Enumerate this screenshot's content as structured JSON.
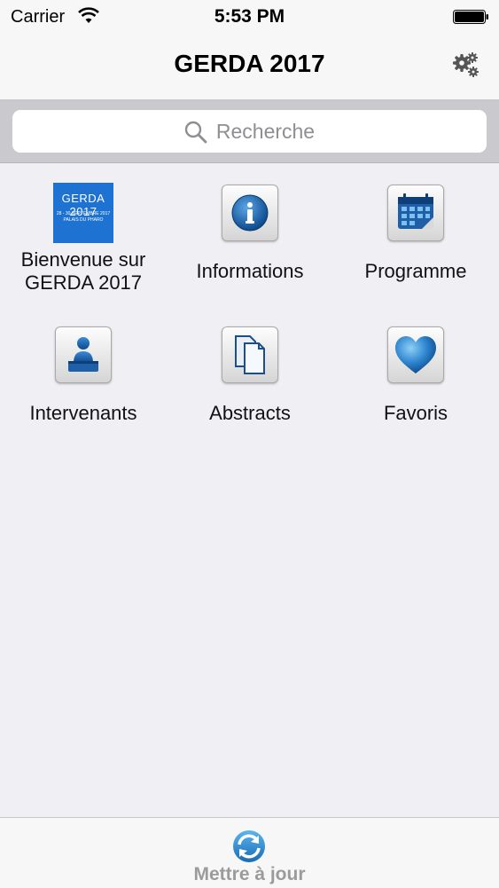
{
  "status_bar": {
    "carrier": "Carrier",
    "time": "5:53 PM"
  },
  "nav": {
    "title": "GERDA 2017"
  },
  "search": {
    "placeholder": "Recherche"
  },
  "tiles": [
    {
      "label": "Bienvenue sur GERDA 2017",
      "icon": "gerda-logo",
      "logo_title": "GERDA 2017",
      "logo_sub1": "28 - 30 SEPTEMBRE 2017",
      "logo_sub2": "PALAIS DU PHARO"
    },
    {
      "label": "Informations",
      "icon": "info-icon"
    },
    {
      "label": "Programme",
      "icon": "calendar-icon"
    },
    {
      "label": "Intervenants",
      "icon": "speaker-icon"
    },
    {
      "label": "Abstracts",
      "icon": "documents-icon"
    },
    {
      "label": "Favoris",
      "icon": "heart-icon"
    }
  ],
  "tab_bar": {
    "update_label": "Mettre à jour",
    "icon": "refresh-icon"
  },
  "colors": {
    "accent": "#1e73d2",
    "background": "#efeff4",
    "search_bar": "#c9c9ce"
  }
}
